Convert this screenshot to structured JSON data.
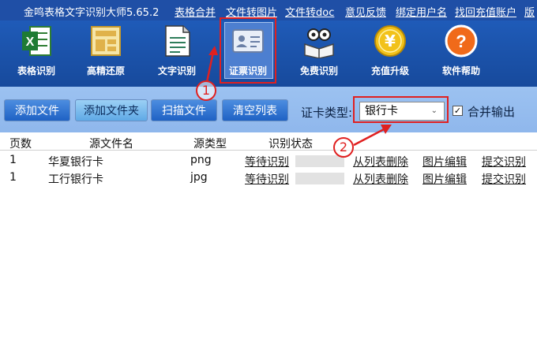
{
  "app": {
    "title": "金鸣表格文字识别大师5.65.2"
  },
  "menu": [
    "表格合并",
    "文件转图片",
    "文件转doc",
    "意见反馈",
    "绑定用户名",
    "找回充值账户",
    "版"
  ],
  "tools": [
    {
      "label": "表格识别",
      "icon": "excel-icon"
    },
    {
      "label": "高精还原",
      "icon": "layout-icon"
    },
    {
      "label": "文字识别",
      "icon": "document-icon"
    },
    {
      "label": "证票识别",
      "icon": "id-card-icon",
      "selected": true
    },
    {
      "label": "免费识别",
      "icon": "book-reader-icon"
    },
    {
      "label": "充值升级",
      "icon": "coin-icon"
    },
    {
      "label": "软件帮助",
      "icon": "help-icon"
    }
  ],
  "actions": {
    "add_file": "添加文件",
    "add_folder": "添加文件夹",
    "scan": "扫描文件",
    "clear": "清空列表"
  },
  "card_type": {
    "label": "证卡类型:",
    "selected": "银行卡",
    "merge_label": "合并输出",
    "merge_checked": "✓"
  },
  "table": {
    "headers": [
      "页数",
      "源文件名",
      "源类型",
      "识别状态"
    ],
    "rows": [
      {
        "pages": "1",
        "name": "华夏银行卡",
        "type": "png",
        "status": "等待识别",
        "progress": 0,
        "del": "从列表删除",
        "edit": "图片编辑",
        "submit": "提交识别"
      },
      {
        "pages": "1",
        "name": "工行银行卡",
        "type": "jpg",
        "status": "等待识别",
        "progress": 0,
        "del": "从列表删除",
        "edit": "图片编辑",
        "submit": "提交识别"
      }
    ]
  },
  "annotations": {
    "one": "1",
    "two": "2",
    "color": "#e02020"
  }
}
